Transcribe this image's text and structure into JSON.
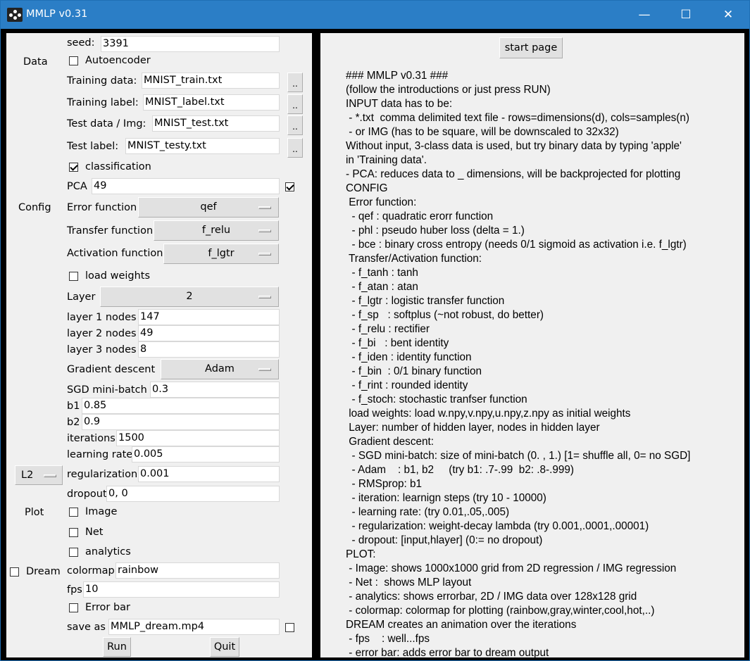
{
  "window": {
    "title": "MMLP v0.31",
    "min": "—",
    "max": "☐",
    "close": "✕"
  },
  "sections": {
    "data": "Data",
    "config": "Config",
    "plot": "Plot",
    "dream": "Dream"
  },
  "form": {
    "seed": {
      "label": "seed:",
      "value": "3391"
    },
    "autoencoder": "Autoencoder",
    "training_data": {
      "label": "Training data:",
      "value": "MNIST_train.txt"
    },
    "training_label": {
      "label": "Training label:",
      "value": "MNIST_label.txt"
    },
    "test_data": {
      "label": "Test data / Img:",
      "value": "MNIST_test.txt"
    },
    "test_label": {
      "label": "Test label:",
      "value": "MNIST_testy.txt"
    },
    "browse": "..",
    "classification": "classification",
    "pca": {
      "label": "PCA",
      "value": "49"
    },
    "error_function": {
      "label": "Error function",
      "value": "qef"
    },
    "transfer_function": {
      "label": "Transfer function",
      "value": "f_relu"
    },
    "activation_function": {
      "label": "Activation function",
      "value": "f_lgtr"
    },
    "load_weights": "load weights",
    "layer": {
      "label": "Layer",
      "value": "2"
    },
    "layer1": {
      "label": "layer 1 nodes",
      "value": "147"
    },
    "layer2": {
      "label": "layer 2 nodes",
      "value": "49"
    },
    "layer3": {
      "label": "layer 3 nodes",
      "value": "8"
    },
    "gradient_descent": {
      "label": "Gradient descent",
      "value": "Adam"
    },
    "sgd": {
      "label": "SGD mini-batch",
      "value": "0.3"
    },
    "b1": {
      "label": "b1",
      "value": "0.85"
    },
    "b2": {
      "label": "b2",
      "value": "0.9"
    },
    "iterations": {
      "label": "iterations",
      "value": "1500"
    },
    "learning_rate": {
      "label": "learning rate",
      "value": "0.005"
    },
    "reg_type": "L2",
    "regularization": {
      "label": "regularization",
      "value": "0.001"
    },
    "dropout": {
      "label": "dropout",
      "value": "0, 0"
    },
    "image": "Image",
    "net": "Net",
    "analytics": "analytics",
    "colormap": {
      "label": "colormap",
      "value": "rainbow"
    },
    "fps": {
      "label": "fps",
      "value": "10"
    },
    "error_bar": "Error bar",
    "save_as": {
      "label": "save as",
      "value": "MMLP_dream.mp4"
    },
    "run": "Run",
    "quit": "Quit"
  },
  "help": {
    "start_page": "start page",
    "text": "### MMLP v0.31 ###\n(follow the introductions or just press RUN)\nINPUT data has to be:\n - *.txt  comma delimited text file - rows=dimensions(d), cols=samples(n)\n - or IMG (has to be square, will be downscaled to 32x32)\nWithout input, 3-class data is used, but try binary data by typing 'apple'\nin 'Training data'.\n- PCA: reduces data to _ dimensions, will be backprojected for plotting\nCONFIG\n Error function:\n  - qef : quadratic erorr function\n  - phl : pseudo huber loss (delta = 1.)\n  - bce : binary cross entropy (needs 0/1 sigmoid as activation i.e. f_lgtr)\n Transfer/Activation function:\n  - f_tanh : tanh\n  - f_atan : atan\n  - f_lgtr : logistic transfer function\n  - f_sp   : softplus (~not robust, do better)\n  - f_relu : rectifier\n  - f_bi   : bent identity\n  - f_iden : identity function\n  - f_bin  : 0/1 binary function\n  - f_rint : rounded identity\n  - f_stoch: stochastic tranfser function\n load weights: load w.npy,v.npy,u.npy,z.npy as initial weights\n Layer: number of hidden layer, nodes in hidden layer\n Gradient descent:\n  - SGD mini-batch: size of mini-batch (0. , 1.) [1= shuffle all, 0= no SGD]\n  - Adam    : b1, b2     (try b1: .7-.99  b2: .8-.999)\n  - RMSprop: b1\n  - iteration: learnign steps (try 10 - 10000)\n  - learning rate: (try 0.01,.05,.005)\n  - regularization: weight-decay lambda (try 0.001,.0001,.00001)\n  - dropout: [input,hlayer] (0:= no dropout)\nPLOT:\n - Image: shows 1000x1000 grid from 2D regression / IMG regression\n - Net :  shows MLP layout\n - analytics: shows errorbar, 2D / IMG data over 128x128 grid\n - colormap: colormap for plotting (rainbow,gray,winter,cool,hot,..)\nDREAM creates an animation over the iterations\n - fps    : well...fps\n - error bar: adds error bar to dream output"
  }
}
